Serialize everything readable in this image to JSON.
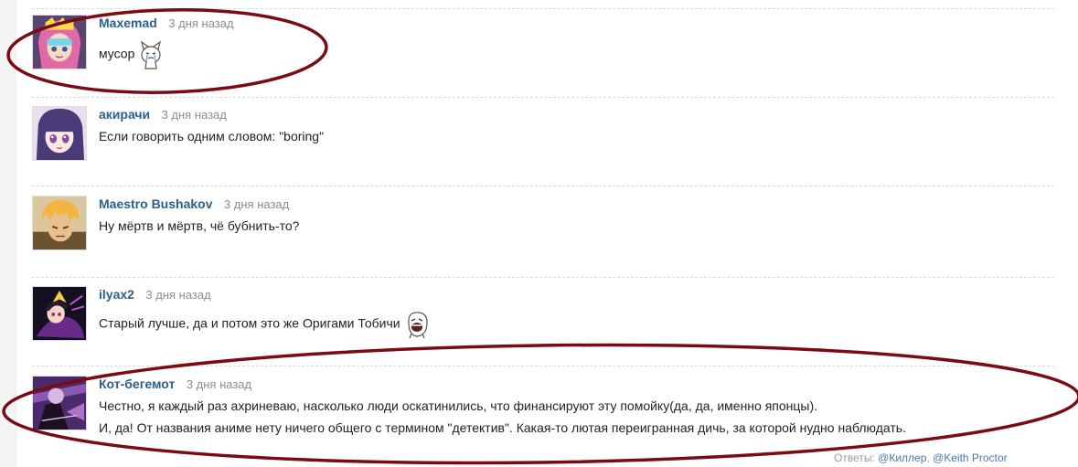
{
  "comments": [
    {
      "username": "Maxemad",
      "time": "3 дня назад",
      "lines": [
        "мусор"
      ],
      "emoticon": "crying-cat-icon"
    },
    {
      "username": "акирачи",
      "time": "3 дня назад",
      "lines": [
        "Если говорить одним словом: \"boring\""
      ]
    },
    {
      "username": "Maestro Bushakov",
      "time": "3 дня назад",
      "lines": [
        "Ну мёртв и мёртв, чё бубнить-то?"
      ]
    },
    {
      "username": "ilyax2",
      "time": "3 дня назад",
      "lines": [
        "Старый лучше, да и потом это же Оригами Тобичи"
      ],
      "emoticon": "laughing-face-icon"
    },
    {
      "username": "Кот-бегемот",
      "time": "3 дня назад",
      "lines": [
        "Честно, я каждый раз ахриневаю, насколько люди оскатинились, что финансируют эту помойку(да, да, именно японцы).",
        "И, да! От названия аниме нету ничего общего с термином \"детектив\". Какая-то лютая переигранная дичь, за которой нудно наблюдать."
      ]
    }
  ],
  "reply": {
    "prefix": "Ответы:",
    "links": [
      "@Киллер",
      "@Keith Proctor"
    ],
    "separator": ", "
  },
  "colors": {
    "username": "#2b5f8c",
    "timestamp": "#8c8c8c",
    "annotation_ellipse": "#7a0a14"
  }
}
